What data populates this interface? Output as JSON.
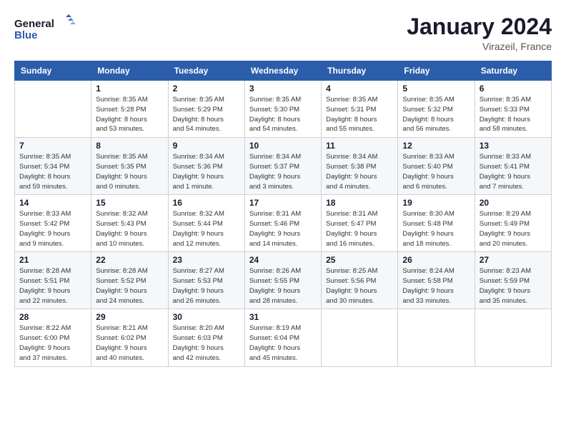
{
  "logo": {
    "line1": "General",
    "line2": "Blue"
  },
  "title": "January 2024",
  "location": "Virazeil, France",
  "days_of_week": [
    "Sunday",
    "Monday",
    "Tuesday",
    "Wednesday",
    "Thursday",
    "Friday",
    "Saturday"
  ],
  "weeks": [
    [
      {
        "day": "",
        "info": ""
      },
      {
        "day": "1",
        "info": "Sunrise: 8:35 AM\nSunset: 5:28 PM\nDaylight: 8 hours\nand 53 minutes."
      },
      {
        "day": "2",
        "info": "Sunrise: 8:35 AM\nSunset: 5:29 PM\nDaylight: 8 hours\nand 54 minutes."
      },
      {
        "day": "3",
        "info": "Sunrise: 8:35 AM\nSunset: 5:30 PM\nDaylight: 8 hours\nand 54 minutes."
      },
      {
        "day": "4",
        "info": "Sunrise: 8:35 AM\nSunset: 5:31 PM\nDaylight: 8 hours\nand 55 minutes."
      },
      {
        "day": "5",
        "info": "Sunrise: 8:35 AM\nSunset: 5:32 PM\nDaylight: 8 hours\nand 56 minutes."
      },
      {
        "day": "6",
        "info": "Sunrise: 8:35 AM\nSunset: 5:33 PM\nDaylight: 8 hours\nand 58 minutes."
      }
    ],
    [
      {
        "day": "7",
        "info": "Sunrise: 8:35 AM\nSunset: 5:34 PM\nDaylight: 8 hours\nand 59 minutes."
      },
      {
        "day": "8",
        "info": "Sunrise: 8:35 AM\nSunset: 5:35 PM\nDaylight: 9 hours\nand 0 minutes."
      },
      {
        "day": "9",
        "info": "Sunrise: 8:34 AM\nSunset: 5:36 PM\nDaylight: 9 hours\nand 1 minute."
      },
      {
        "day": "10",
        "info": "Sunrise: 8:34 AM\nSunset: 5:37 PM\nDaylight: 9 hours\nand 3 minutes."
      },
      {
        "day": "11",
        "info": "Sunrise: 8:34 AM\nSunset: 5:38 PM\nDaylight: 9 hours\nand 4 minutes."
      },
      {
        "day": "12",
        "info": "Sunrise: 8:33 AM\nSunset: 5:40 PM\nDaylight: 9 hours\nand 6 minutes."
      },
      {
        "day": "13",
        "info": "Sunrise: 8:33 AM\nSunset: 5:41 PM\nDaylight: 9 hours\nand 7 minutes."
      }
    ],
    [
      {
        "day": "14",
        "info": "Sunrise: 8:33 AM\nSunset: 5:42 PM\nDaylight: 9 hours\nand 9 minutes."
      },
      {
        "day": "15",
        "info": "Sunrise: 8:32 AM\nSunset: 5:43 PM\nDaylight: 9 hours\nand 10 minutes."
      },
      {
        "day": "16",
        "info": "Sunrise: 8:32 AM\nSunset: 5:44 PM\nDaylight: 9 hours\nand 12 minutes."
      },
      {
        "day": "17",
        "info": "Sunrise: 8:31 AM\nSunset: 5:46 PM\nDaylight: 9 hours\nand 14 minutes."
      },
      {
        "day": "18",
        "info": "Sunrise: 8:31 AM\nSunset: 5:47 PM\nDaylight: 9 hours\nand 16 minutes."
      },
      {
        "day": "19",
        "info": "Sunrise: 8:30 AM\nSunset: 5:48 PM\nDaylight: 9 hours\nand 18 minutes."
      },
      {
        "day": "20",
        "info": "Sunrise: 8:29 AM\nSunset: 5:49 PM\nDaylight: 9 hours\nand 20 minutes."
      }
    ],
    [
      {
        "day": "21",
        "info": "Sunrise: 8:28 AM\nSunset: 5:51 PM\nDaylight: 9 hours\nand 22 minutes."
      },
      {
        "day": "22",
        "info": "Sunrise: 8:28 AM\nSunset: 5:52 PM\nDaylight: 9 hours\nand 24 minutes."
      },
      {
        "day": "23",
        "info": "Sunrise: 8:27 AM\nSunset: 5:53 PM\nDaylight: 9 hours\nand 26 minutes."
      },
      {
        "day": "24",
        "info": "Sunrise: 8:26 AM\nSunset: 5:55 PM\nDaylight: 9 hours\nand 28 minutes."
      },
      {
        "day": "25",
        "info": "Sunrise: 8:25 AM\nSunset: 5:56 PM\nDaylight: 9 hours\nand 30 minutes."
      },
      {
        "day": "26",
        "info": "Sunrise: 8:24 AM\nSunset: 5:58 PM\nDaylight: 9 hours\nand 33 minutes."
      },
      {
        "day": "27",
        "info": "Sunrise: 8:23 AM\nSunset: 5:59 PM\nDaylight: 9 hours\nand 35 minutes."
      }
    ],
    [
      {
        "day": "28",
        "info": "Sunrise: 8:22 AM\nSunset: 6:00 PM\nDaylight: 9 hours\nand 37 minutes."
      },
      {
        "day": "29",
        "info": "Sunrise: 8:21 AM\nSunset: 6:02 PM\nDaylight: 9 hours\nand 40 minutes."
      },
      {
        "day": "30",
        "info": "Sunrise: 8:20 AM\nSunset: 6:03 PM\nDaylight: 9 hours\nand 42 minutes."
      },
      {
        "day": "31",
        "info": "Sunrise: 8:19 AM\nSunset: 6:04 PM\nDaylight: 9 hours\nand 45 minutes."
      },
      {
        "day": "",
        "info": ""
      },
      {
        "day": "",
        "info": ""
      },
      {
        "day": "",
        "info": ""
      }
    ]
  ]
}
